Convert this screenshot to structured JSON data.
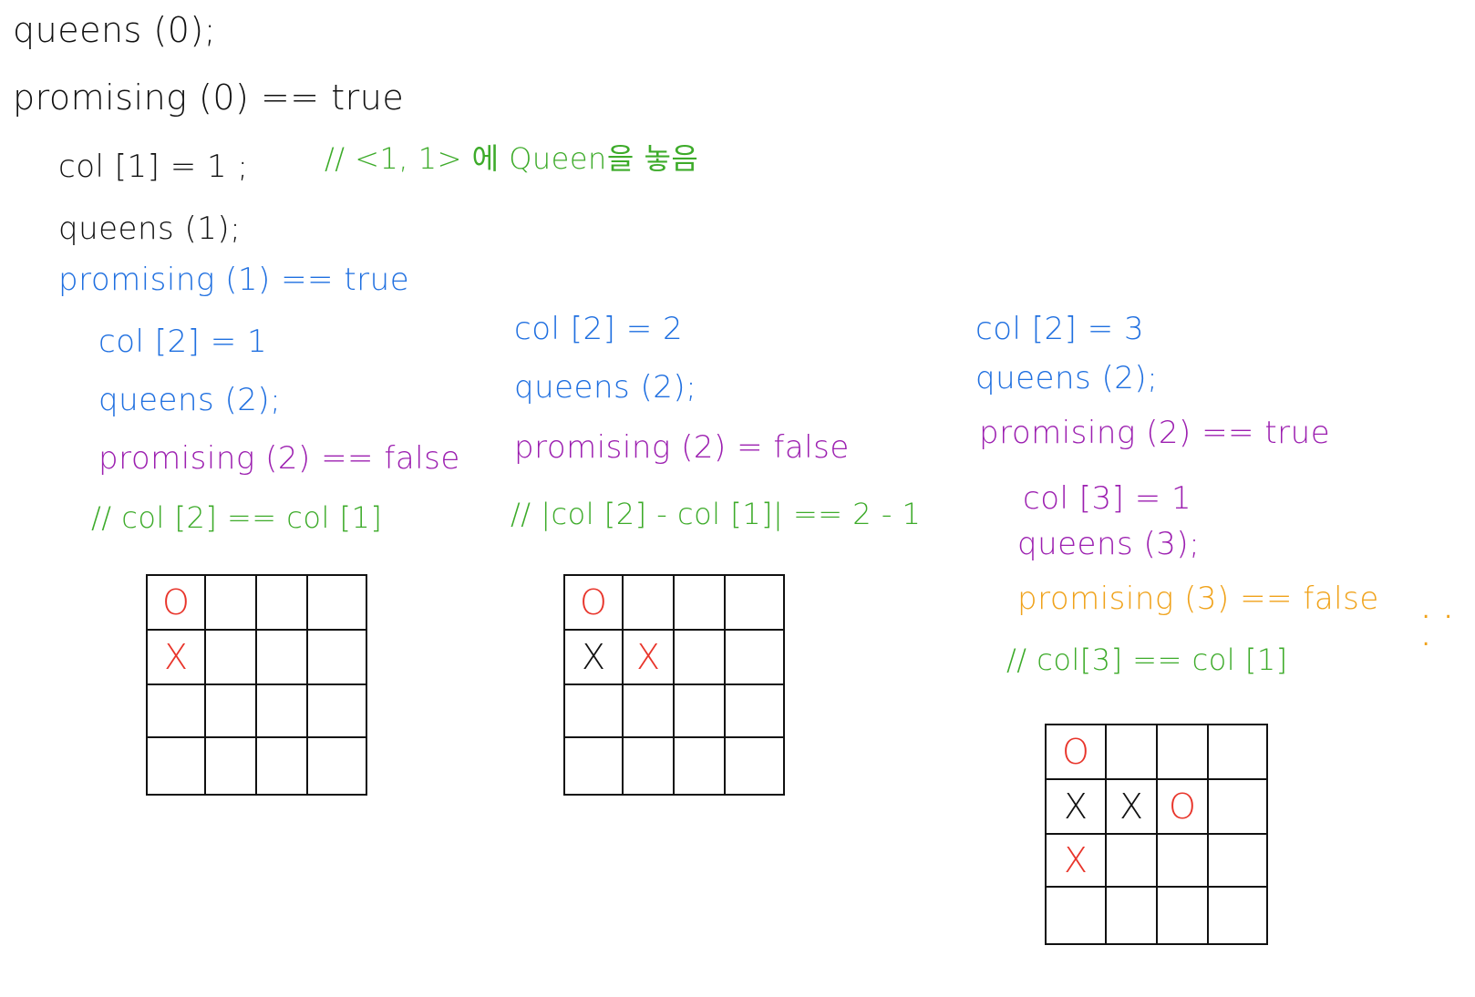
{
  "header": {
    "lines": [
      {
        "text": "queens (0);",
        "color": "#111111"
      },
      {
        "text": "promising (0) == true",
        "color": "#111111"
      },
      {
        "text": "col [1] = 1 ;",
        "color": "#111111"
      },
      {
        "text": "// <1, 1> 에 Queen을 놓음",
        "color": "#3dab2a"
      },
      {
        "text": "queens (1);",
        "color": "#111111"
      },
      {
        "text": "promising (1) == true",
        "color": "#1f6fe0"
      }
    ]
  },
  "columns": [
    {
      "lines": [
        {
          "text": "col [2] = 1",
          "color": "#1f6fe0"
        },
        {
          "text": "queens (2);",
          "color": "#1f6fe0"
        },
        {
          "text": "promising (2) == false",
          "color": "#9c1fb0"
        },
        {
          "text": "// col [2] == col [1]",
          "color": "#3dab2a"
        }
      ],
      "board": [
        [
          "O",
          "",
          "",
          ""
        ],
        [
          "X",
          "",
          "",
          ""
        ],
        [
          "",
          "",
          "",
          ""
        ],
        [
          "",
          "",
          "",
          ""
        ]
      ],
      "board_colors": [
        [
          "red",
          "",
          "",
          ""
        ],
        [
          "red",
          "",
          "",
          ""
        ],
        [
          "",
          "",
          "",
          ""
        ],
        [
          "",
          "",
          "",
          ""
        ]
      ]
    },
    {
      "lines": [
        {
          "text": "col [2] = 2",
          "color": "#1f6fe0"
        },
        {
          "text": "queens (2);",
          "color": "#1f6fe0"
        },
        {
          "text": "promising (2) = false",
          "color": "#9c1fb0"
        },
        {
          "text": "// |col [2] - col [1]| == 2 - 1",
          "color": "#3dab2a"
        }
      ],
      "board": [
        [
          "O",
          "",
          "",
          ""
        ],
        [
          "X",
          "X",
          "",
          ""
        ],
        [
          "",
          "",
          "",
          ""
        ],
        [
          "",
          "",
          "",
          ""
        ]
      ],
      "board_colors": [
        [
          "red",
          "",
          "",
          ""
        ],
        [
          "black",
          "red",
          "",
          ""
        ],
        [
          "",
          "",
          "",
          ""
        ],
        [
          "",
          "",
          "",
          ""
        ]
      ]
    },
    {
      "lines": [
        {
          "text": "col [2] = 3",
          "color": "#1f6fe0"
        },
        {
          "text": "queens (2);",
          "color": "#1f6fe0"
        },
        {
          "text": "promising (2) == true",
          "color": "#9c1fb0"
        },
        {
          "text": "col [3] = 1",
          "color": "#9c1fb0"
        },
        {
          "text": "queens (3);",
          "color": "#9c1fb0"
        },
        {
          "text": "promising (3) == false",
          "color": "#f0a21a"
        },
        {
          "text": "// col[3] == col [1]",
          "color": "#3dab2a"
        }
      ],
      "board": [
        [
          "O",
          "",
          "",
          ""
        ],
        [
          "X",
          "X",
          "O",
          ""
        ],
        [
          "X",
          "",
          "",
          ""
        ],
        [
          "",
          "",
          "",
          ""
        ]
      ],
      "board_colors": [
        [
          "red",
          "",
          "",
          ""
        ],
        [
          "black",
          "black",
          "red",
          ""
        ],
        [
          "red",
          "",
          "",
          ""
        ],
        [
          "",
          "",
          "",
          ""
        ]
      ]
    }
  ],
  "ellipsis": ". . ."
}
